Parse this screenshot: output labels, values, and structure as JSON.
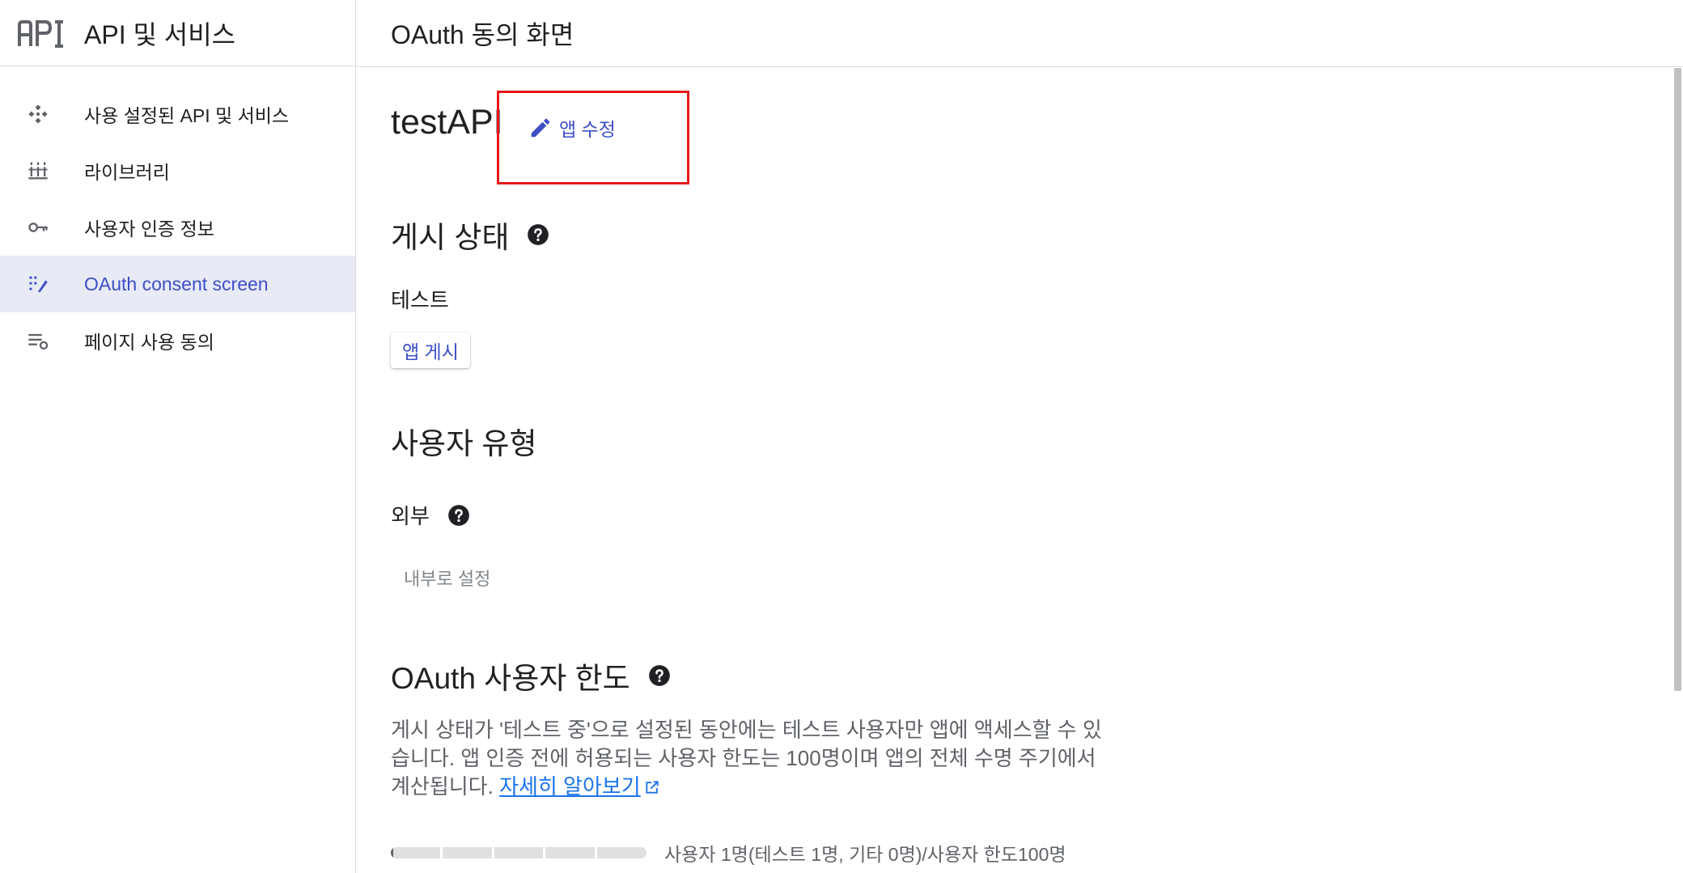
{
  "sidebar": {
    "title": "API 및 서비스",
    "items": [
      {
        "label": "사용 설정된 API 및 서비스",
        "icon": "api-services-icon"
      },
      {
        "label": "라이브러리",
        "icon": "library-icon"
      },
      {
        "label": "사용자 인증 정보",
        "icon": "key-icon"
      },
      {
        "label": "OAuth consent screen",
        "icon": "consent-icon",
        "active": true
      },
      {
        "label": "페이지 사용 동의",
        "icon": "settings-list-icon"
      }
    ]
  },
  "header": {
    "title": "OAuth 동의 화면"
  },
  "app": {
    "name": "testAPI",
    "edit_label": "앱 수정"
  },
  "publishing": {
    "heading": "게시 상태",
    "status": "테스트",
    "publish_button": "앱 게시"
  },
  "user_type": {
    "heading": "사용자 유형",
    "value": "외부",
    "internal_button": "내부로 설정"
  },
  "oauth_limit": {
    "heading": "OAuth 사용자 한도",
    "description": "게시 상태가 '테스트 중'으로 설정된 동안에는 테스트 사용자만 앱에 액세스할 수 있습니다. 앱 인증 전에 허용되는 사용자 한도는 100명이며 앱의 전체 수명 주기에서 계산됩니다.",
    "learn_more": "자세히 알아보기",
    "usage_text": "사용자 1명(테스트 1명, 기타 0명)/사용자 한도100명",
    "used": 1,
    "limit": 100
  },
  "colors": {
    "accent": "#3c4fc7",
    "active_bg": "#e8eaf6",
    "highlight": "#e8161b"
  }
}
